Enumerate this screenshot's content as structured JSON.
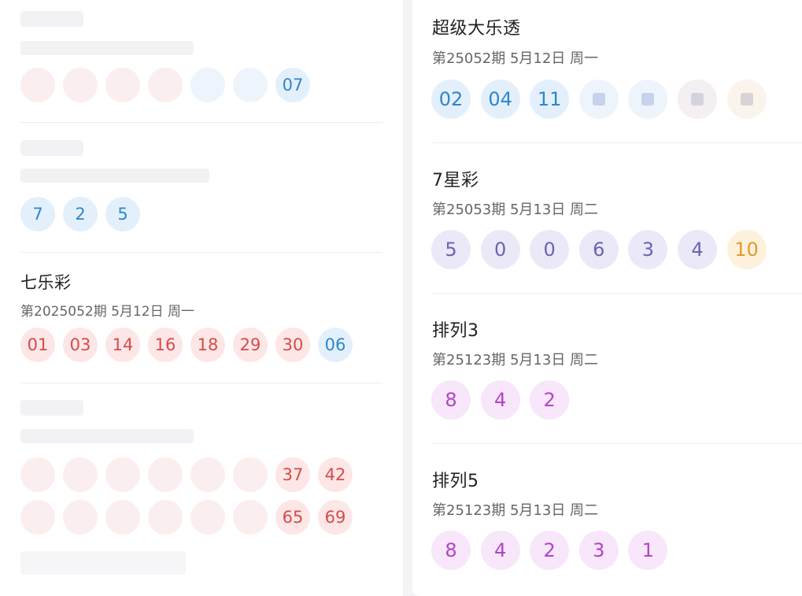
{
  "left": {
    "top_section": {
      "visible_ball": "07"
    },
    "second_section": {
      "balls": [
        "7",
        "2",
        "5"
      ]
    },
    "qlc": {
      "title": "七乐彩",
      "meta": "第2025052期 5月12日 周一",
      "red_balls": [
        "01",
        "03",
        "14",
        "16",
        "18",
        "29",
        "30"
      ],
      "blue_ball": "06"
    },
    "bottom_section": {
      "row1_visible": [
        "37",
        "42"
      ],
      "row2_visible": [
        "65",
        "69"
      ]
    }
  },
  "right": {
    "dlt": {
      "title": "超级大乐透",
      "meta": "第25052期 5月12日 周一",
      "front_balls": [
        "02",
        "04",
        "11"
      ]
    },
    "qxc": {
      "title": "7星彩",
      "meta": "第25053期 5月13日 周二",
      "balls": [
        "5",
        "0",
        "0",
        "6",
        "3",
        "4"
      ],
      "special_ball": "10"
    },
    "pl3": {
      "title": "排列3",
      "meta": "第25123期 5月13日 周二",
      "balls": [
        "8",
        "4",
        "2"
      ]
    },
    "pl5": {
      "title": "排列5",
      "meta": "第25123期 5月13日 周二",
      "balls": [
        "8",
        "4",
        "2",
        "3",
        "1"
      ]
    }
  },
  "colors": {
    "red_ball_bg": "#fde6e6",
    "red_ball_text": "#d64b4b",
    "blue_ball_bg": "#e3f0fb",
    "blue_ball_text": "#2f86c9",
    "purple_ball_bg": "#ebe9f8",
    "purple_ball_text": "#6a63b8",
    "orange_ball_bg": "#fdf1dc",
    "orange_ball_text": "#e29a2a",
    "pink_ball_bg": "#f8e6fb",
    "pink_ball_text": "#b046c2"
  }
}
